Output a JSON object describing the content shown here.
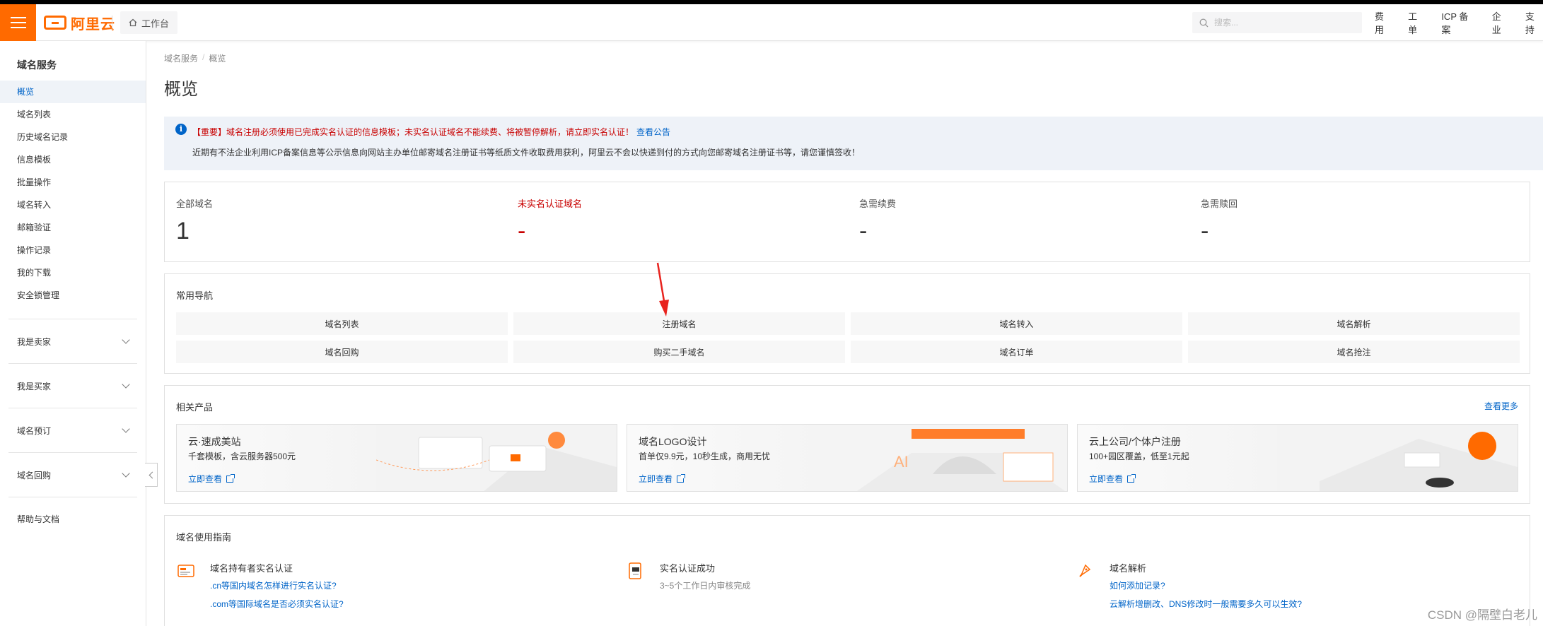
{
  "topbar": {
    "logo_text": "阿里云",
    "workbench": "工作台",
    "search_placeholder": "搜索...",
    "nav": [
      "费用",
      "工单",
      "ICP 备案",
      "企业",
      "支持"
    ]
  },
  "sidebar": {
    "title": "域名服务",
    "items": [
      {
        "label": "概览",
        "active": true
      },
      {
        "label": "域名列表"
      },
      {
        "label": "历史域名记录"
      },
      {
        "label": "信息模板"
      },
      {
        "label": "批量操作"
      },
      {
        "label": "域名转入"
      },
      {
        "label": "邮箱验证"
      },
      {
        "label": "操作记录"
      },
      {
        "label": "我的下载"
      },
      {
        "label": "安全锁管理"
      }
    ],
    "groups": [
      "我是卖家",
      "我是买家",
      "域名预订",
      "域名回购"
    ],
    "help": "帮助与文档"
  },
  "breadcrumb": [
    "域名服务",
    "概览"
  ],
  "page_title": "概览",
  "notice": {
    "line1": "【重要】域名注册必须使用已完成实名认证的信息模板；未实名认证域名不能续费、将被暂停解析，请立即实名认证！",
    "link": "查看公告",
    "line2": "近期有不法企业利用ICP备案信息等公示信息向网站主办单位邮寄域名注册证书等纸质文件收取费用获利，阿里云不会以快递到付的方式向您邮寄域名注册证书等，请您谨慎签收！"
  },
  "stats": [
    {
      "label": "全部域名",
      "value": "1",
      "color": "#333333"
    },
    {
      "label": "未实名认证域名",
      "value": "-",
      "color": "#c80000"
    },
    {
      "label": "急需续费",
      "value": "-",
      "color": "#333333"
    },
    {
      "label": "急需赎回",
      "value": "-",
      "color": "#333333"
    }
  ],
  "common_nav": {
    "title": "常用导航",
    "items": [
      "域名列表",
      "注册域名",
      "域名转入",
      "域名解析",
      "域名回购",
      "购买二手域名",
      "域名订单",
      "域名抢注"
    ]
  },
  "products": {
    "title": "相关产品",
    "more": "查看更多",
    "items": [
      {
        "name": "云·速成美站",
        "desc": "千套模板，含云服务器500元",
        "link": "立即查看"
      },
      {
        "name": "域名LOGO设计",
        "desc": "首单仅9.9元，10秒生成，商用无忧",
        "link": "立即查看"
      },
      {
        "name": "云上公司/个体户注册",
        "desc": "100+园区覆盖，低至1元起",
        "link": "立即查看"
      }
    ]
  },
  "guide": {
    "title": "域名使用指南",
    "cols": [
      {
        "title": "域名持有者实名认证",
        "links": [
          ".cn等国内域名怎样进行实名认证?",
          ".com等国际域名是否必须实名认证?"
        ]
      },
      {
        "title": "实名认证成功",
        "links": [
          "3~5个工作日内审核完成"
        ]
      },
      {
        "title": "域名解析",
        "links": [
          "如何添加记录?",
          "云解析增删改、DNS修改时一般需要多久可以生效?"
        ]
      }
    ]
  },
  "watermark": "CSDN @隔壁白老儿",
  "colors": {
    "brand": "#ff6a00",
    "link": "#0064c8",
    "alert": "#c80000",
    "annotation_arrow": "#e8231e"
  }
}
